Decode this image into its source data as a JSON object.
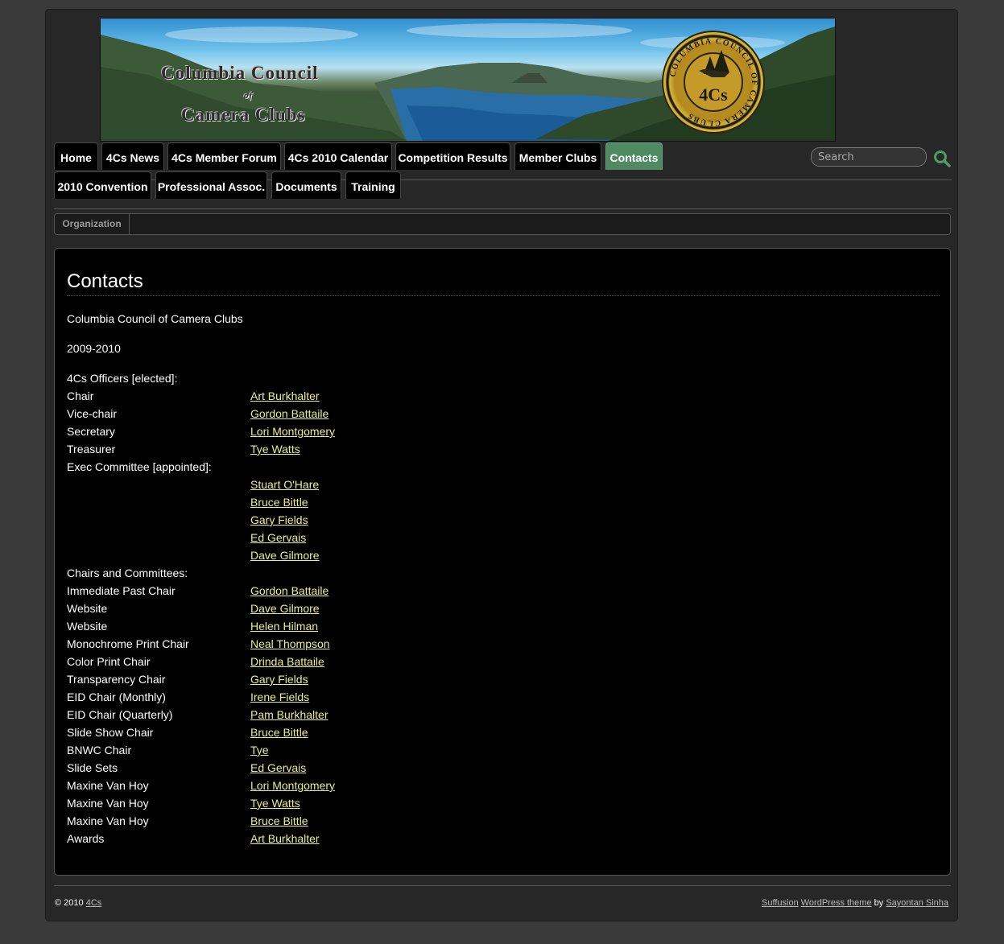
{
  "banner": {
    "line1": "Columbia Council",
    "line2": "of",
    "line3": "Camera Clubs",
    "seal_text": "4Cs",
    "seal_ring_text": "COLUMBIA COUNCIL OF CAMERA CLUBS"
  },
  "nav": {
    "row1": [
      "Home",
      "4Cs News",
      "4Cs Member Forum",
      "4Cs 2010 Calendar",
      "Competition Results",
      "Member Clubs",
      "Contacts"
    ],
    "row2": [
      "2010 Convention",
      "Professional Assoc.",
      "Documents",
      "Training"
    ],
    "active": "Contacts"
  },
  "search": {
    "placeholder": "Search"
  },
  "subnav": {
    "item": "Organization"
  },
  "page": {
    "title": "Contacts",
    "org_name": "Columbia Council of Camera Clubs",
    "year": "2009-2010",
    "officers_heading": "4Cs Officers [elected]:",
    "officers": [
      {
        "role": "Chair",
        "name": "Art Burkhalter"
      },
      {
        "role": "Vice-chair",
        "name": "Gordon Battaile"
      },
      {
        "role": "Secretary",
        "name": "Lori Montgomery"
      },
      {
        "role": "Treasurer",
        "name": "Tye Watts"
      }
    ],
    "exec_heading": "Exec Committee [appointed]:",
    "exec_members": [
      "Stuart O'Hare",
      "Bruce Bittle",
      "Gary Fields",
      "Ed Gervais",
      "Dave Gilmore"
    ],
    "chairs_heading": "Chairs and Committees:",
    "chairs": [
      {
        "role": "Immediate Past Chair",
        "name": "Gordon Battaile"
      },
      {
        "role": "Website",
        "name": "Dave Gilmore"
      },
      {
        "role": "Website",
        "name": "Helen Hilman"
      },
      {
        "role": "Monochrome Print Chair",
        "name": "Neal Thompson"
      },
      {
        "role": "Color Print Chair",
        "name": "Drinda Battaile"
      },
      {
        "role": "Transparency Chair",
        "name": "Gary Fields"
      },
      {
        "role": "EID Chair (Monthly)",
        "name": "Irene Fields"
      },
      {
        "role": "EID Chair (Quarterly)",
        "name": "Pam Burkhalter"
      },
      {
        "role": "Slide Show Chair",
        "name": "Bruce Bittle"
      },
      {
        "role": "BNWC Chair",
        "name": "Tye"
      },
      {
        "role": "Slide Sets",
        "name": "Ed Gervais"
      },
      {
        "role": "Maxine Van Hoy",
        "name": "Lori Montgomery"
      },
      {
        "role": "Maxine Van Hoy",
        "name": "Tye Watts"
      },
      {
        "role": "Maxine Van Hoy",
        "name": "Bruce Bittle"
      },
      {
        "role": "Awards",
        "name": "Art Burkhalter"
      }
    ]
  },
  "footer": {
    "copyright": "© 2010",
    "site_link": "4Cs",
    "theme_link": "Suffusion",
    "wp_link": "WordPress theme",
    "by": "by",
    "author_link": "Sayontan Sinha"
  },
  "colors": {
    "link": "#eeee88",
    "active_tab": "#4f8a63",
    "search_icon": "#4f9a6b"
  }
}
